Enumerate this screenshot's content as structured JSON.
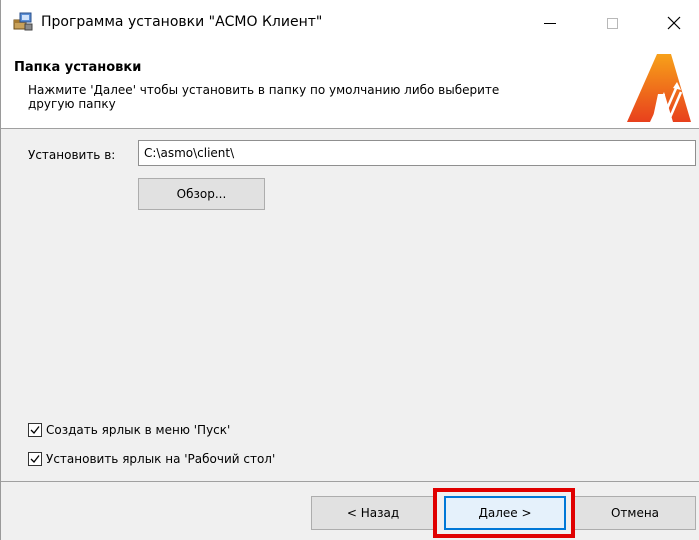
{
  "window": {
    "title": "Программа установки \"АСМО Клиент\"",
    "icons": {
      "app": "installer-icon",
      "minimize": "minimize-icon",
      "maximize": "maximize-icon",
      "close": "close-icon"
    }
  },
  "banner": {
    "title": "Папка установки",
    "description": "Нажмите 'Далее' чтобы установить в папку по умолчанию либо выберите другую папку",
    "logo_icon": "asmo-logo-icon"
  },
  "install_path": {
    "label": "Установить в:",
    "value": "C:\\asmo\\client\\"
  },
  "buttons": {
    "browse": "Обзор...",
    "back": "< Назад",
    "next": "Далее >",
    "cancel": "Отмена"
  },
  "options": [
    {
      "label": "Создать ярлык в меню 'Пуск'",
      "checked": true
    },
    {
      "label": "Установить ярлык на 'Рабочий стол'",
      "checked": true
    }
  ],
  "colors": {
    "highlight": "#e00000",
    "default_button_border": "#0078d7",
    "logo_orange": "#f0701f"
  }
}
